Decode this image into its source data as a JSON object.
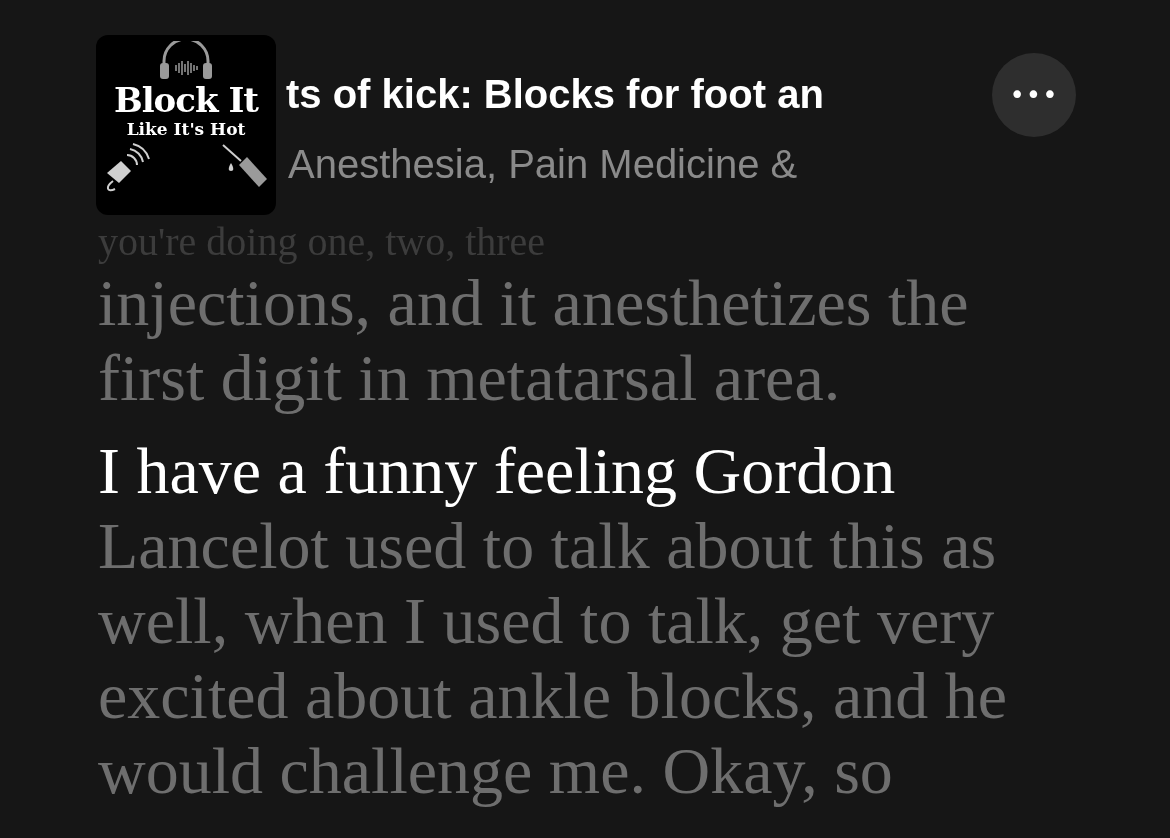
{
  "header": {
    "artwork": {
      "title": "Block It",
      "subtitle": "Like It's Hot"
    },
    "episode_title": "ts of kick: Blocks for foot an",
    "show_name": "Anesthesia, Pain Medicine &",
    "more_button": "•••"
  },
  "transcript": [
    {
      "chunks": [
        {
          "text": "you're doing one, two, three",
          "spoken": false,
          "faded": true
        },
        {
          "text": "injections, and it anesthetizes the first digit in metatarsal area.",
          "spoken": false,
          "faded": false
        }
      ]
    },
    {
      "chunks": [
        {
          "text": "I have a funny feeling Gordon",
          "spoken": true,
          "faded": false
        },
        {
          "text": "Lancelot used to talk about this as well, when I used to talk, get very excited about ankle blocks, and he would challenge me. Okay, so",
          "spoken": false,
          "faded": false
        }
      ]
    }
  ]
}
